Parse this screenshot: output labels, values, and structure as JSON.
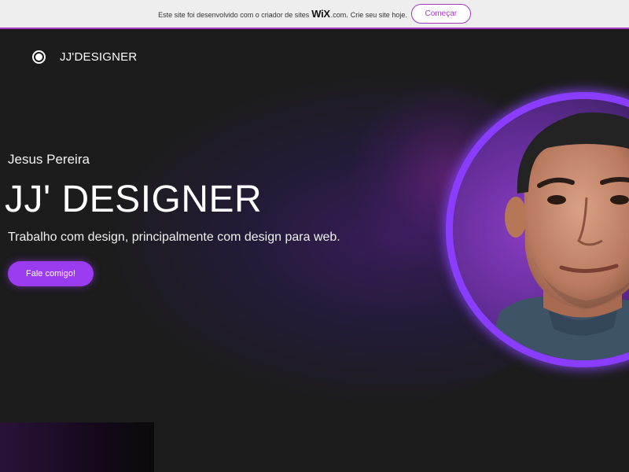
{
  "banner": {
    "text": "Este site foi desenvolvido com o criador de sites",
    "logo": "WiX",
    "logo_suffix": ".com.",
    "text_after": "Crie seu site hoje.",
    "cta_label": "Começar"
  },
  "header": {
    "logo_text": "JJ'DESIGNER",
    "logo_icon": "radio-dot-icon"
  },
  "hero": {
    "name": "Jesus Pereira",
    "title": "JJ' DESIGNER",
    "subtitle": "Trabalho com design, principalmente com design para web.",
    "cta_label": "Fale comigo!"
  },
  "colors": {
    "accent": "#9b3cf0",
    "ring": "#8b3dff",
    "background": "#1c1c1c",
    "banner_accent": "#a23bbf"
  }
}
